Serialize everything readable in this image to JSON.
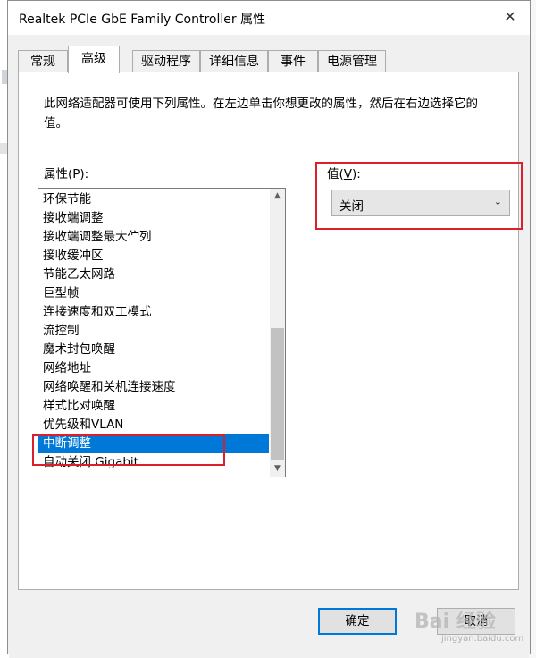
{
  "window": {
    "title": "Realtek PCIe GbE Family Controller 属性",
    "close_glyph": "✕"
  },
  "tabs": [
    {
      "label": "常规"
    },
    {
      "label": "高级",
      "active": true
    },
    {
      "label": "驱动程序"
    },
    {
      "label": "详细信息"
    },
    {
      "label": "事件"
    },
    {
      "label": "电源管理"
    }
  ],
  "advanced": {
    "description": "此网络适配器可使用下列属性。在左边单击你想更改的属性，然后在右边选择它的值。",
    "property_label": "属性(P):",
    "value_label_prefix": "值(",
    "value_label_key": "V",
    "value_label_suffix": "):",
    "properties": [
      "环保节能",
      "接收端调整",
      "接收端调整最大伫列",
      "接收缓冲区",
      "节能乙太网路",
      "巨型帧",
      "连接速度和双工模式",
      "流控制",
      "魔术封包唤醒",
      "网络地址",
      "网络唤醒和关机连接速度",
      "样式比对唤醒",
      "优先级和VLAN",
      "中断调整",
      "自动关闭 Gigabit"
    ],
    "selected_property": "中断调整",
    "selected_index": 13,
    "value": "关闭"
  },
  "buttons": {
    "ok": "确定",
    "cancel": "取消"
  },
  "watermark": {
    "main": "Bai 经验",
    "sub": "jingyan.baidu.com"
  },
  "icons": {
    "scroll_up": "▲",
    "scroll_down": "▼",
    "dropdown": "⌄"
  },
  "colors": {
    "selection": "#0078d7",
    "highlight": "#d9202b"
  }
}
